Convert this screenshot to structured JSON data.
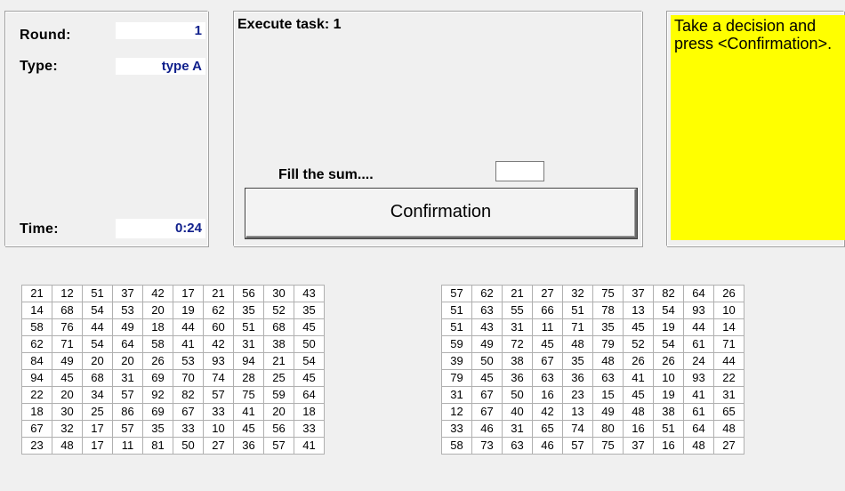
{
  "info": {
    "round_label": "Round:",
    "round_value": "1",
    "type_label": "Type:",
    "type_value": "type A",
    "time_label": "Time:",
    "time_value": "0:24"
  },
  "task": {
    "title": "Execute task: 1",
    "fill_label": "Fill the sum....",
    "sum_value": "",
    "confirm_label": "Confirmation"
  },
  "message": {
    "text": "Take a decision and press <Confirmation>.",
    "background": "#ffff00"
  },
  "grid_left": [
    [
      21,
      12,
      51,
      37,
      42,
      17,
      21,
      56,
      30,
      43
    ],
    [
      14,
      68,
      54,
      53,
      20,
      19,
      62,
      35,
      52,
      35
    ],
    [
      58,
      76,
      44,
      49,
      18,
      44,
      60,
      51,
      68,
      45
    ],
    [
      62,
      71,
      54,
      64,
      58,
      41,
      42,
      31,
      38,
      50
    ],
    [
      84,
      49,
      20,
      20,
      26,
      53,
      93,
      94,
      21,
      54
    ],
    [
      94,
      45,
      68,
      31,
      69,
      70,
      74,
      28,
      25,
      45
    ],
    [
      22,
      20,
      34,
      57,
      92,
      82,
      57,
      75,
      59,
      64
    ],
    [
      18,
      30,
      25,
      86,
      69,
      67,
      33,
      41,
      20,
      18
    ],
    [
      67,
      32,
      17,
      57,
      35,
      33,
      10,
      45,
      56,
      33
    ],
    [
      23,
      48,
      17,
      11,
      81,
      50,
      27,
      36,
      57,
      41
    ]
  ],
  "grid_right": [
    [
      57,
      62,
      21,
      27,
      32,
      75,
      37,
      82,
      64,
      26
    ],
    [
      51,
      63,
      55,
      66,
      51,
      78,
      13,
      54,
      93,
      10
    ],
    [
      51,
      43,
      31,
      11,
      71,
      35,
      45,
      19,
      44,
      14
    ],
    [
      59,
      49,
      72,
      45,
      48,
      79,
      52,
      54,
      61,
      71
    ],
    [
      39,
      50,
      38,
      67,
      35,
      48,
      26,
      26,
      24,
      44
    ],
    [
      79,
      45,
      36,
      63,
      36,
      63,
      41,
      10,
      93,
      22
    ],
    [
      31,
      67,
      50,
      16,
      23,
      15,
      45,
      19,
      41,
      31
    ],
    [
      12,
      67,
      40,
      42,
      13,
      49,
      48,
      38,
      61,
      65
    ],
    [
      33,
      46,
      31,
      65,
      74,
      80,
      16,
      51,
      64,
      48
    ],
    [
      58,
      73,
      63,
      46,
      57,
      75,
      37,
      16,
      48,
      27
    ]
  ]
}
